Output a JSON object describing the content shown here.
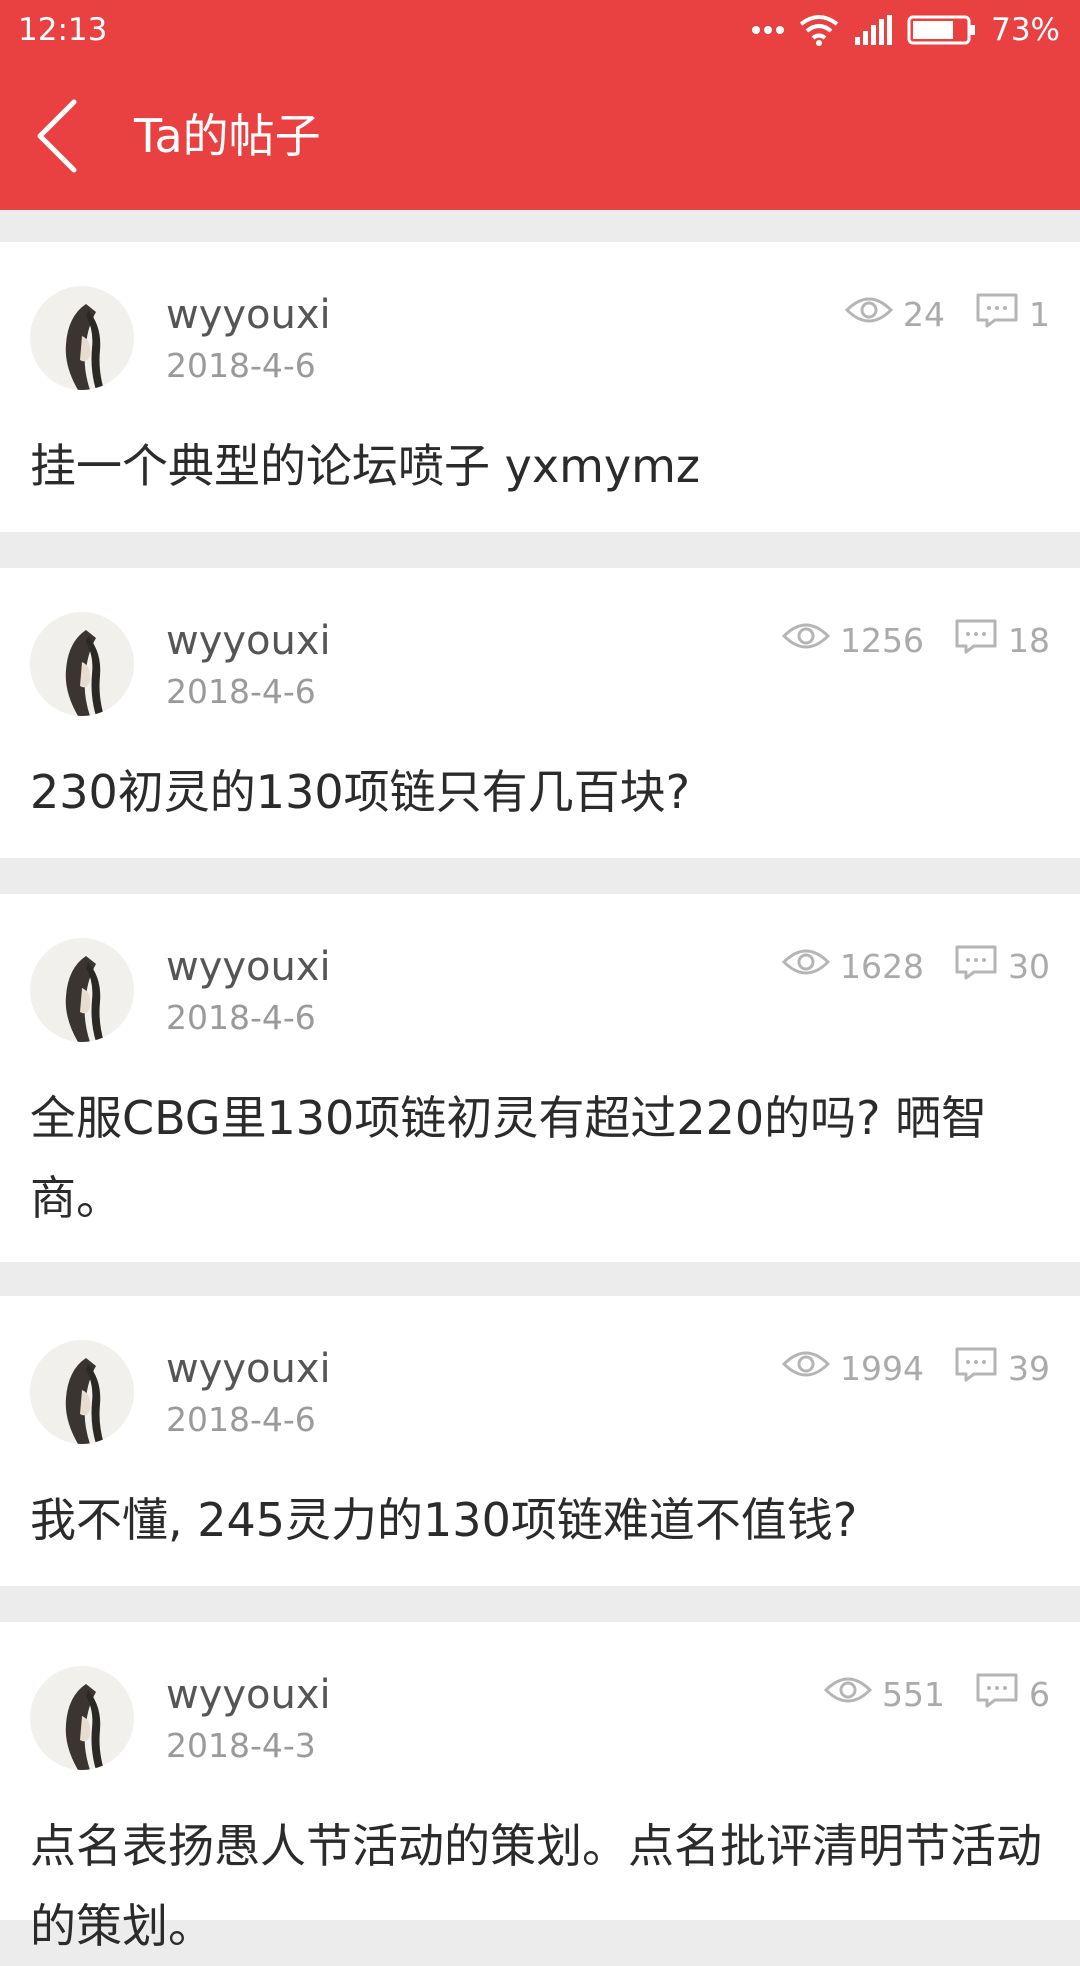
{
  "status_bar": {
    "time": "12:13",
    "battery": "73%"
  },
  "header": {
    "title": "Ta的帖子"
  },
  "posts": [
    {
      "username": "wyyouxi",
      "date": "2018-4-6",
      "views": "24",
      "comments": "1",
      "title": "挂一个典型的论坛喷子 yxmymz"
    },
    {
      "username": "wyyouxi",
      "date": "2018-4-6",
      "views": "1256",
      "comments": "18",
      "title": "230初灵的130项链只有几百块?"
    },
    {
      "username": "wyyouxi",
      "date": "2018-4-6",
      "views": "1628",
      "comments": "30",
      "title": "全服CBG里130项链初灵有超过220的吗? 晒智商。"
    },
    {
      "username": "wyyouxi",
      "date": "2018-4-6",
      "views": "1994",
      "comments": "39",
      "title": "我不懂, 245灵力的130项链难道不值钱?"
    },
    {
      "username": "wyyouxi",
      "date": "2018-4-3",
      "views": "551",
      "comments": "6",
      "title": "点名表扬愚人节活动的策划。点名批评清明节活动的策划。"
    }
  ],
  "colors": {
    "accent": "#e94141",
    "background": "#ececec"
  }
}
